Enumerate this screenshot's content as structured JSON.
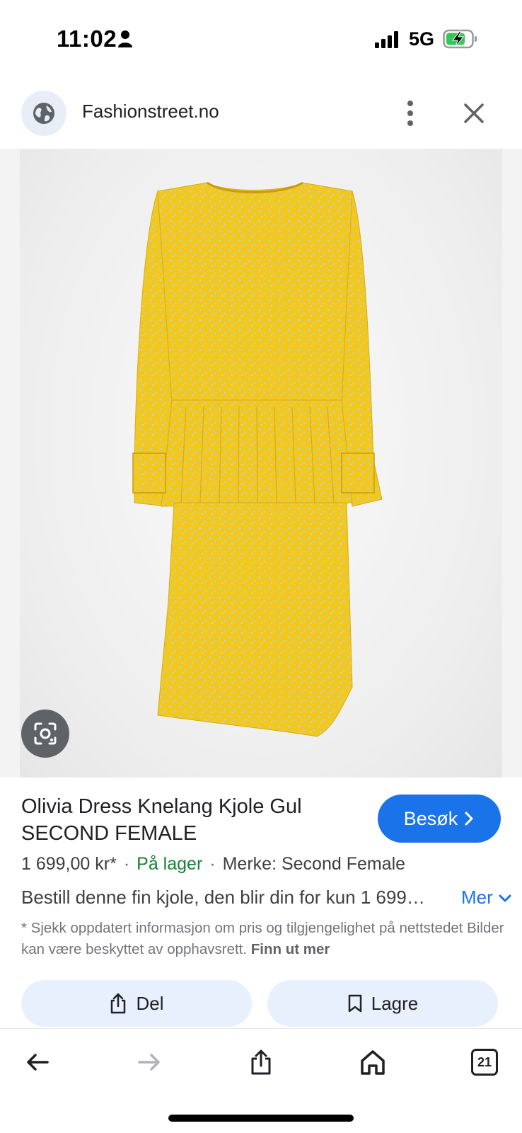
{
  "status_bar": {
    "time": "11:02",
    "network": "5G",
    "icons": [
      "person-icon",
      "signal-icon",
      "battery-charging-icon"
    ]
  },
  "tab": {
    "site": "Fashionstreet.no",
    "icons": [
      "globe-icon",
      "more-vert-icon",
      "close-icon"
    ]
  },
  "product": {
    "title_line1": "Olivia Dress Knelang Kjole Gul",
    "title_line2": "SECOND FEMALE",
    "visit_label": "Besøk",
    "price": "1 699,00 kr*",
    "stock": "På lager",
    "brand": "Merke: Second Female",
    "description": "Bestill denne fin kjole, den blir din for kun 1 699…",
    "more_label": "Mer",
    "disclaimer": "* Sjekk oppdatert informasjon om pris og tilgjengelighet på nettstedet Bilder kan være beskyttet av opphavsrett.",
    "learn_more": "Finn ut mer"
  },
  "actions": {
    "share_label": "Del",
    "save_label": "Lagre"
  },
  "bottom_nav": {
    "tab_count": "21",
    "icons": [
      "back-arrow-icon",
      "forward-arrow-icon",
      "share-icon",
      "home-icon",
      "tabs-icon"
    ]
  },
  "colors": {
    "accent": "#1a73e8",
    "in_stock": "#188038",
    "dress": "#f2c81e",
    "button_bg": "#e8f0fe"
  }
}
